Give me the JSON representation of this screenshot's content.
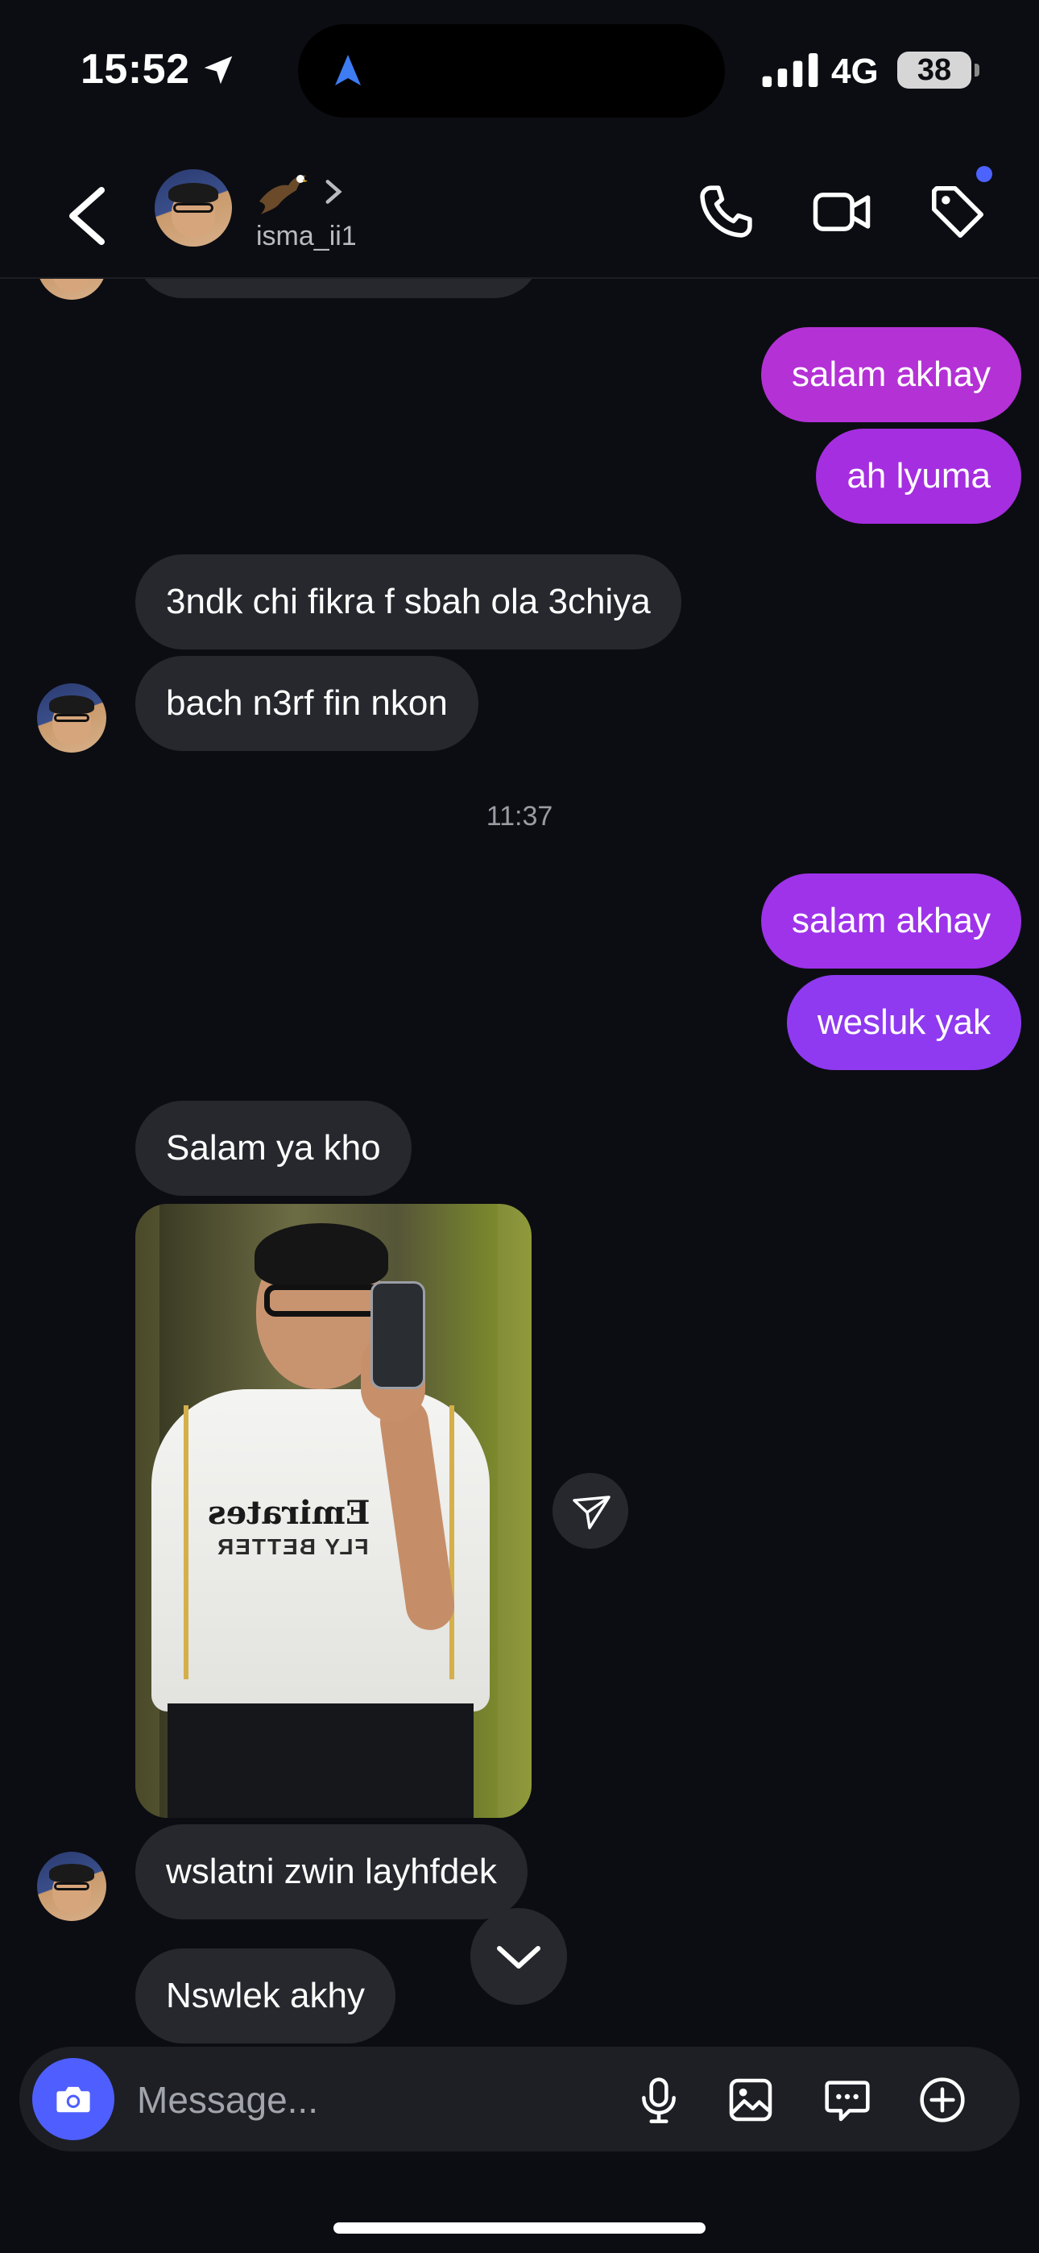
{
  "status_bar": {
    "time": "15:52",
    "network": "4G",
    "battery": "38"
  },
  "header": {
    "username": "isma_ii1"
  },
  "messages": [
    {
      "type": "sent",
      "text": "salam akhay"
    },
    {
      "type": "sent",
      "text": "ah lyuma"
    },
    {
      "type": "received",
      "text": "3ndk chi fikra f sbah ola 3chiya"
    },
    {
      "type": "received",
      "text": "bach n3rf fin nkon"
    },
    {
      "type": "timestamp",
      "text": "11:37"
    },
    {
      "type": "sent",
      "text": "salam akhay"
    },
    {
      "type": "sent",
      "text": "wesluk yak"
    },
    {
      "type": "received",
      "text": "Salam ya kho"
    },
    {
      "type": "received_photo",
      "shirt_text_1": "Emirates",
      "shirt_text_2": "FLY BETTER"
    },
    {
      "type": "received",
      "text": "wslatni zwin layhfdek"
    },
    {
      "type": "received",
      "text": "Nswlek akhy"
    }
  ],
  "composer": {
    "placeholder": "Message..."
  },
  "colors": {
    "background": "#0c0d12",
    "received_bubble": "#26282d",
    "sent_bubble_top": "#b431d6",
    "sent_bubble_bottom": "#8f3af0",
    "accent": "#4f5fff"
  },
  "icons": {
    "header": [
      "back-arrow-icon",
      "eagle-emoji-icon",
      "chevron-right-icon",
      "phone-icon",
      "video-camera-icon",
      "tag-icon"
    ],
    "composer": [
      "camera-icon",
      "microphone-icon",
      "image-icon",
      "chat-sticker-icon",
      "plus-circle-icon"
    ]
  }
}
